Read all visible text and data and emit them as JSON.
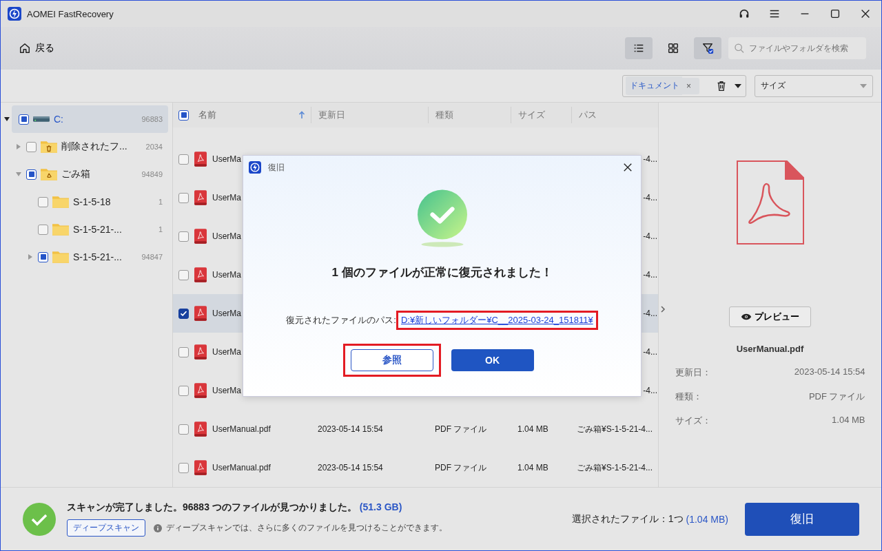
{
  "window": {
    "title": "AOMEI FastRecovery"
  },
  "toolbar": {
    "back": "戻る",
    "views": [
      {
        "kind": "list",
        "selected": true
      },
      {
        "kind": "grid",
        "selected": false
      }
    ],
    "filter_active": true,
    "search": {
      "placeholder": "ファイルやフォルダを検索"
    }
  },
  "filters": {
    "tag": "ドキュメント",
    "tag_close": "×",
    "sort": "サイズ"
  },
  "tree": [
    {
      "name": "C:",
      "count": "96883",
      "kind": "drive",
      "partial": true,
      "selected": true,
      "expandable": true,
      "expanded": true,
      "children": [
        {
          "name": "削除されたフ...",
          "count": "2034",
          "kind": "deleted",
          "partial": false,
          "selected": false,
          "expandable": true,
          "expanded": false
        },
        {
          "name": "ごみ箱",
          "count": "94849",
          "kind": "recycle",
          "partial": true,
          "selected": false,
          "expandable": true,
          "expanded": true,
          "children": [
            {
              "name": "S-1-5-18",
              "count": "1",
              "kind": "folder",
              "partial": false,
              "selected": false,
              "expandable": false
            },
            {
              "name": "S-1-5-21-...",
              "count": "1",
              "kind": "folder",
              "partial": false,
              "selected": false,
              "expandable": false
            },
            {
              "name": "S-1-5-21-...",
              "count": "94847",
              "kind": "folder",
              "partial": true,
              "selected": false,
              "expandable": true,
              "expanded": false
            }
          ]
        }
      ]
    }
  ],
  "table": {
    "select_all_partial": true,
    "columns": [
      {
        "label": "名前",
        "sorted": true
      },
      {
        "label": "更新日",
        "sorted": false
      },
      {
        "label": "種類",
        "sorted": false
      },
      {
        "label": "サイズ",
        "sorted": false
      },
      {
        "label": "パス",
        "sorted": false
      }
    ],
    "rows": [
      {
        "name": "UserMa",
        "path": "-4...",
        "checked": false,
        "selected": false
      },
      {
        "name": "UserMa",
        "path": "-4...",
        "checked": false,
        "selected": false
      },
      {
        "name": "UserMa",
        "path": "-4...",
        "checked": false,
        "selected": false
      },
      {
        "name": "UserMa",
        "path": "-4...",
        "checked": false,
        "selected": false
      },
      {
        "name": "UserMa",
        "path": "-4...",
        "checked": true,
        "selected": true
      },
      {
        "name": "UserMa",
        "path": "-4...",
        "checked": false,
        "selected": false
      },
      {
        "name": "UserMa",
        "path": "-4...",
        "checked": false,
        "selected": false
      },
      {
        "name": "UserManual.pdf",
        "date": "2023-05-14 15:54",
        "type": "PDF ファイル",
        "size": "1.04 MB",
        "path": "ごみ箱¥S-1-5-21-4...",
        "checked": false,
        "selected": false
      },
      {
        "name": "UserManual.pdf",
        "date": "2023-05-14 15:54",
        "type": "PDF ファイル",
        "size": "1.04 MB",
        "path": "ごみ箱¥S-1-5-21-4...",
        "checked": false,
        "selected": false
      }
    ]
  },
  "preview": {
    "button": "プレビュー",
    "file_name": "UserManual.pdf",
    "details": [
      {
        "label": "更新日：",
        "value": "2023-05-14 15:54"
      },
      {
        "label": "種類：",
        "value": "PDF ファイル"
      },
      {
        "label": "サイズ：",
        "value": "1.04 MB"
      }
    ]
  },
  "dialog": {
    "title": "復旧",
    "heading": "1 個のファイルが正常に復元されました！",
    "path_label": "復元されたファイルのパス:",
    "path": "D:¥新しいフォルダー¥C__2025-03-24_151811¥",
    "path_highlighted": true,
    "buttons": [
      {
        "label": "参照",
        "kind": "secondary",
        "highlighted": true
      },
      {
        "label": "OK",
        "kind": "primary",
        "highlighted": false
      }
    ]
  },
  "status_bar": {
    "message": "スキャンが完了しました。96883 つのファイルが見つかりました。",
    "total_size": "(51.3 GB)",
    "deep_scan": "ディープスキャン",
    "hint": "ディープスキャンでは、さらに多くのファイルを見つけることができます。",
    "selected": "選択されたファイル：1つ",
    "selected_size": "(1.04 MB)",
    "recover": "復旧"
  }
}
